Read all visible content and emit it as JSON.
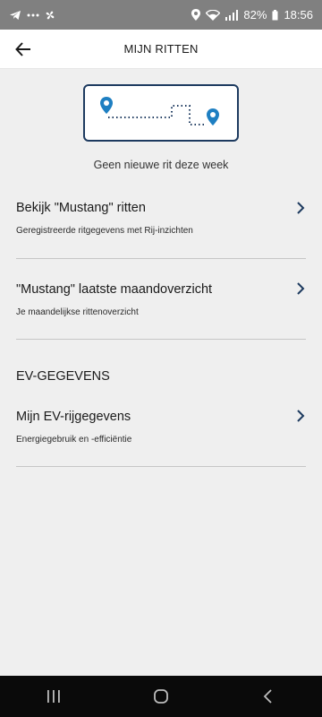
{
  "status_bar": {
    "battery": "82%",
    "time": "18:56",
    "icons": [
      "telegram-icon",
      "more-dots-icon",
      "fan-icon",
      "location-icon",
      "wifi-icon",
      "signal-icon",
      "battery-icon"
    ]
  },
  "app_bar": {
    "title": "MIJN RITTEN",
    "back_icon": "arrow-left-icon"
  },
  "illustration": {
    "icon": "route-map-icon",
    "accent_color": "#1e7fc2",
    "frame_color": "#1d3a5f"
  },
  "empty_state": {
    "text": "Geen nieuwe rit deze week"
  },
  "items": [
    {
      "title": "Bekijk \"Mustang\" ritten",
      "subtitle": "Geregistreerde ritgegevens met Rij-inzichten"
    },
    {
      "title": "\"Mustang\" laatste maandoverzicht",
      "subtitle": "Je maandelijkse rittenoverzicht"
    }
  ],
  "ev_section": {
    "header": "EV-GEGEVENS",
    "item": {
      "title": "Mijn EV-rijgegevens",
      "subtitle": "Energiegebruik en -efficiëntie"
    }
  },
  "nav_bar": {
    "icons": [
      "recent-apps-icon",
      "home-icon",
      "back-icon"
    ]
  }
}
